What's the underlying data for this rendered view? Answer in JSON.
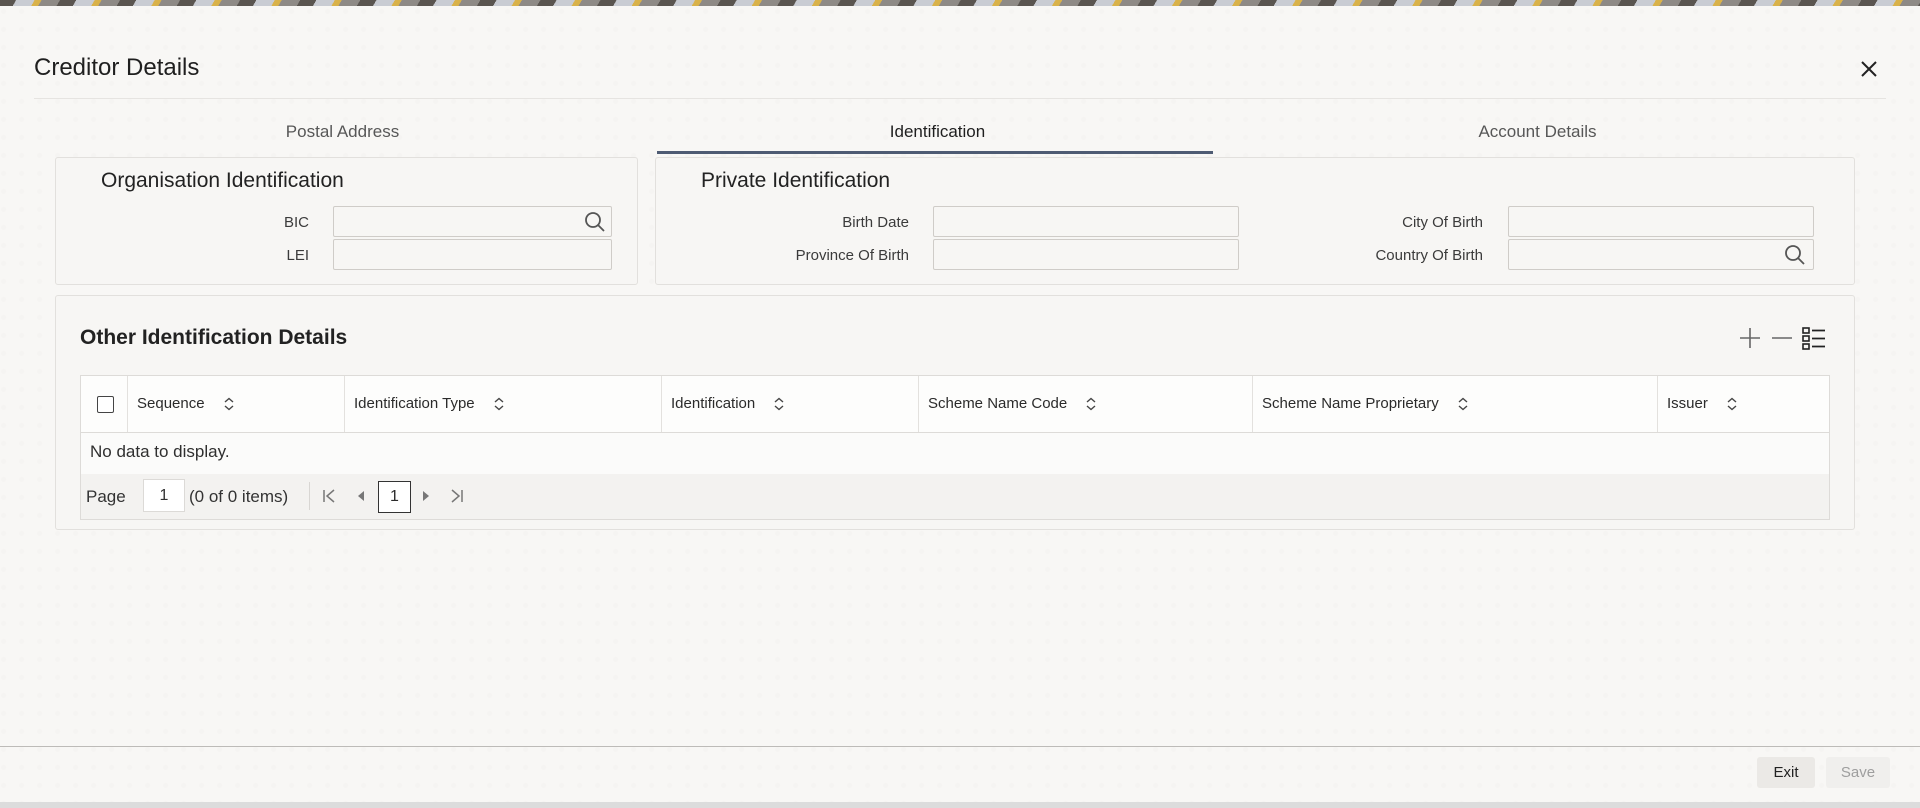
{
  "dialog": {
    "title": "Creditor Details",
    "close_icon": "close-icon"
  },
  "tabs": [
    {
      "label": "Postal Address",
      "active": false
    },
    {
      "label": "Identification",
      "active": true
    },
    {
      "label": "Account Details",
      "active": false
    }
  ],
  "organisation": {
    "title": "Organisation Identification",
    "bic_label": "BIC",
    "bic_value": "",
    "lei_label": "LEI",
    "lei_value": ""
  },
  "private": {
    "title": "Private Identification",
    "birth_date_label": "Birth Date",
    "birth_date_value": "",
    "province_label": "Province Of Birth",
    "province_value": "",
    "city_label": "City Of Birth",
    "city_value": "",
    "country_label": "Country Of Birth",
    "country_value": ""
  },
  "other_ident": {
    "title": "Other Identification Details",
    "columns": [
      "Sequence",
      "Identification Type",
      "Identification",
      "Scheme Name Code",
      "Scheme Name Proprietary",
      "Issuer"
    ],
    "rows": [],
    "empty_text": "No data to display.",
    "pager": {
      "page_label": "Page",
      "page_value": "1",
      "items_text": "(0 of 0 items)",
      "current_page": "1"
    }
  },
  "footer": {
    "exit_label": "Exit",
    "save_label": "Save"
  },
  "colors": {
    "accent": "#4e5b73",
    "background": "#f8f7f5",
    "disabled_text": "#9e9e9e"
  }
}
